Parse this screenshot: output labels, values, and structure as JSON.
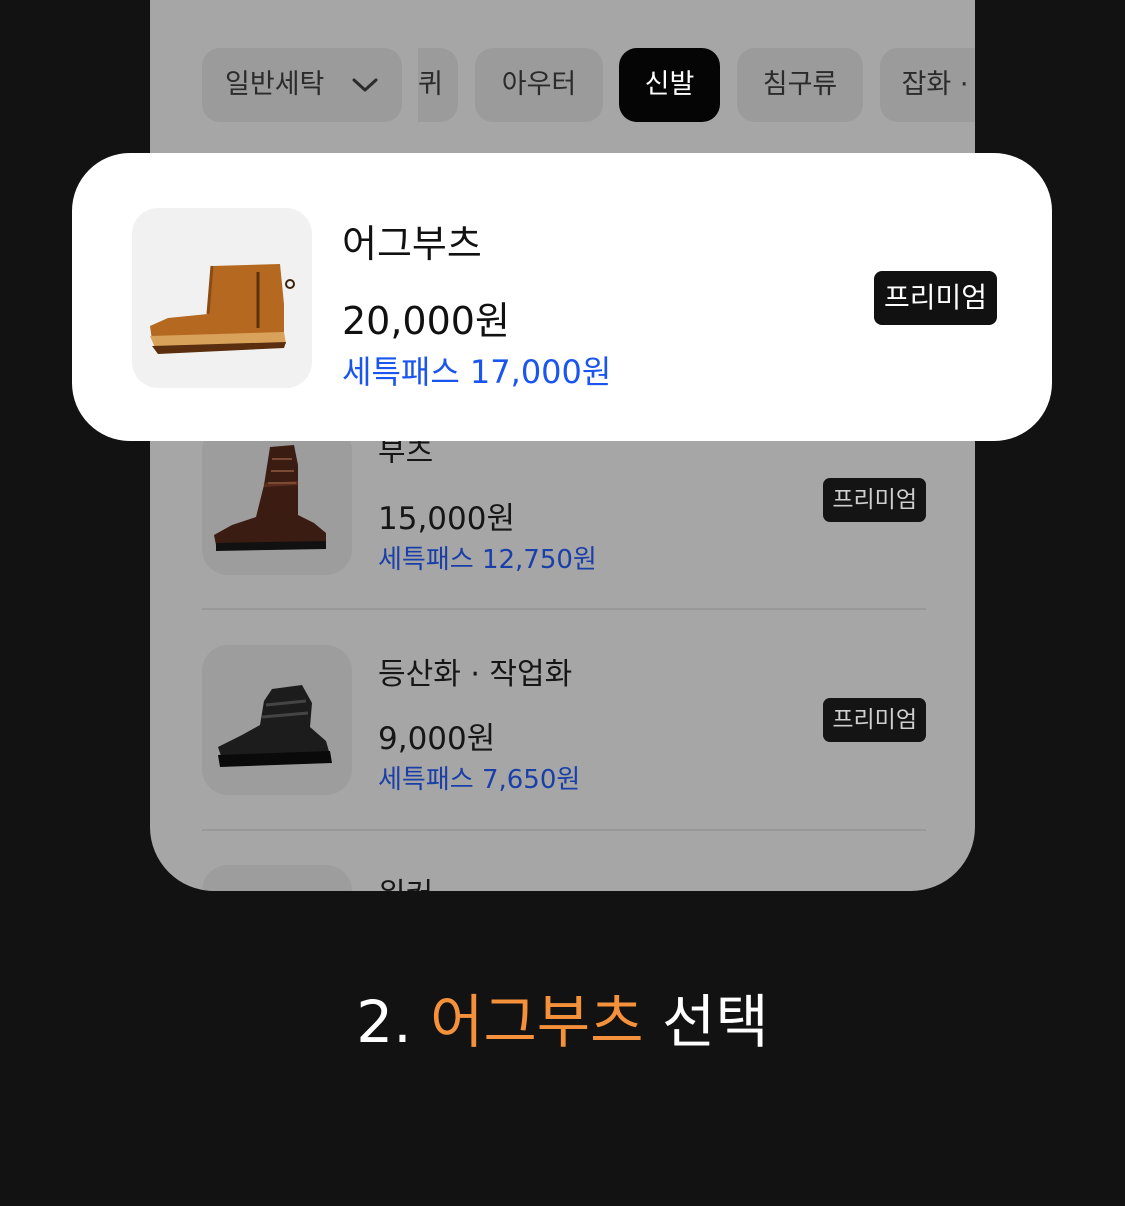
{
  "tabs": {
    "dropdown_label": "일반세탁",
    "items": [
      {
        "label": "퀴"
      },
      {
        "label": "아우터"
      },
      {
        "label": "신발",
        "active": true
      },
      {
        "label": "침구류"
      },
      {
        "label": "잡화 ·"
      }
    ]
  },
  "selected_item": {
    "name": "어그부츠",
    "price": "20,000원",
    "setpass_price": "세특패스 17,000원",
    "badge": "프리미엄",
    "image": "ugg-boot-image"
  },
  "items": [
    {
      "name": "부츠",
      "price": "15,000원",
      "setpass_price": "세특패스 12,750원",
      "badge": "프리미엄",
      "image": "leather-boot-image"
    },
    {
      "name": "등산화 · 작업화",
      "price": "9,000원",
      "setpass_price": "세특패스 7,650원",
      "badge": "프리미엄",
      "image": "hiking-boot-image"
    },
    {
      "name": "워커",
      "image": "walker-image"
    }
  ],
  "caption": {
    "prefix": "2. ",
    "highlight": "어그부츠",
    "suffix": " 선택",
    "highlight_color": "#f5913a"
  }
}
